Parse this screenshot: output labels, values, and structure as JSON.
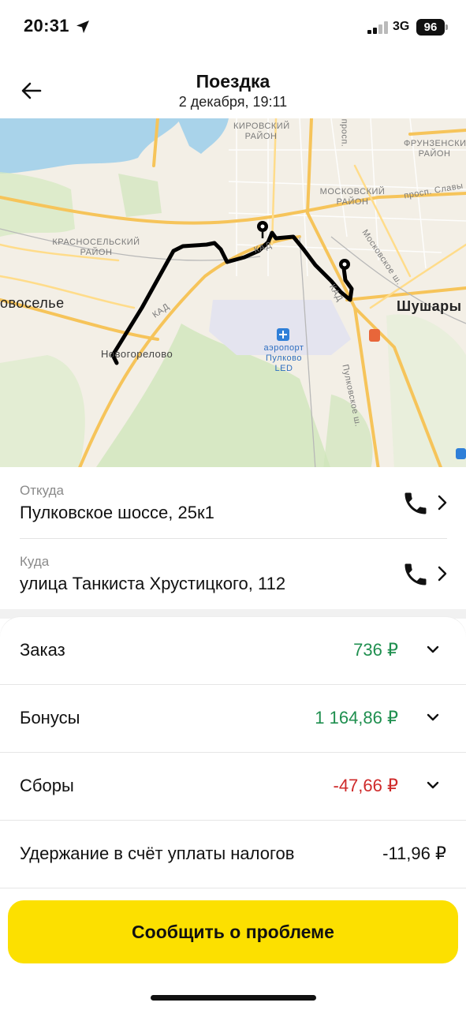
{
  "status_bar": {
    "time": "20:31",
    "network": "3G",
    "battery": "96"
  },
  "header": {
    "title": "Поездка",
    "subtitle": "2 декабря, 19:11",
    "back_icon": "arrow-left-icon"
  },
  "map": {
    "labels": {
      "kirovsky": "КИРОВСКИЙ РАЙОН",
      "frunzensky": "ФРУНЗЕНСКИЙ РАЙОН",
      "moskovsky": "МОСКОВСКИЙ РАЙОН",
      "krasnoselsky": "КРАСНОСЕЛЬСКИЙ РАЙОН",
      "prosp": "просп.",
      "prosp_slavy": "просп. Славы",
      "moskovskoe_sh": "Московское ш.",
      "kad1": "КАД",
      "kad2": "КАД",
      "kad3": "КАД",
      "voselye": "овоселье",
      "shushary": "Шушары",
      "nevogorelovo": "Новогорелово",
      "airport": "аэропорт Пулково LED",
      "pulkovskoe": "Пулковское ш."
    }
  },
  "route": {
    "from": {
      "label": "Откуда",
      "address": "Пулковское шоссе, 25к1"
    },
    "to": {
      "label": "Куда",
      "address": "улица Танкиста Хрустицкого, 112"
    }
  },
  "finance": {
    "order": {
      "label": "Заказ",
      "value": "736 ₽"
    },
    "bonuses": {
      "label": "Бонусы",
      "value": "1 164,86 ₽"
    },
    "fees": {
      "label": "Сборы",
      "value": "-47,66 ₽"
    },
    "tax": {
      "label": "Удержание в счёт уплаты налогов",
      "value": "-11,96 ₽"
    }
  },
  "colors": {
    "accent": "#fce000",
    "positive": "#1f8f4f",
    "negative": "#cf2a2a"
  },
  "cta": {
    "label": "Сообщить о проблеме"
  }
}
